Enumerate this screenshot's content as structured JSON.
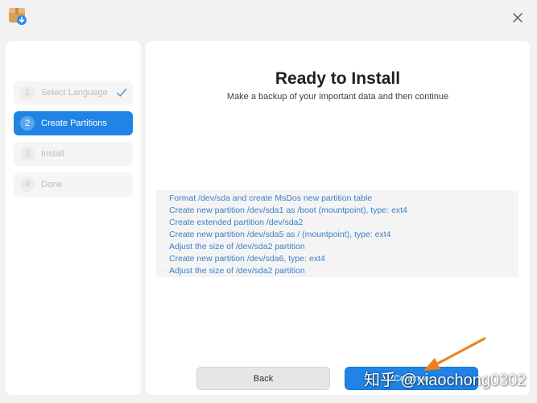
{
  "window": {
    "app_icon": "installer-package-icon",
    "close_icon": "close-icon"
  },
  "steps": [
    {
      "number": "1",
      "label": "Select Language",
      "state": "done"
    },
    {
      "number": "2",
      "label": "Create Partitions",
      "state": "active"
    },
    {
      "number": "3",
      "label": "Install",
      "state": "pending"
    },
    {
      "number": "4",
      "label": "Done",
      "state": "pending"
    }
  ],
  "main": {
    "title": "Ready to Install",
    "subtitle": "Make a backup of your important data and then continue",
    "operations": [
      "Format /dev/sda and create MsDos new partition table",
      "Create new partition /dev/sda1 as /boot (mountpoint), type: ext4",
      "Create extended partition /dev/sda2",
      "Create new partition /dev/sda5 as / (mountpoint), type: ext4",
      "Adjust the size of /dev/sda2 partition",
      "Create new partition /dev/sda6, type: ext4",
      "Adjust the size of /dev/sda2 partition"
    ],
    "bullet": "·"
  },
  "buttons": {
    "back_label": "Back",
    "continue_label": "Continue"
  },
  "colors": {
    "accent": "#1f84e5",
    "operation_text": "#3d7fc4",
    "annotation_arrow": "#f0801e"
  },
  "watermark": "知乎 @xiaochong0302"
}
